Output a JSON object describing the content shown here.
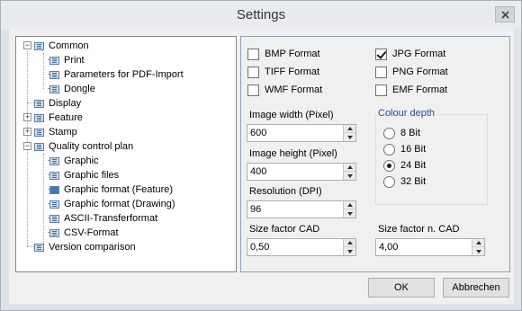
{
  "window": {
    "title": "Settings"
  },
  "tree": {
    "items": [
      {
        "label": "Common"
      },
      {
        "label": "Print"
      },
      {
        "label": "Parameters for PDF-Import"
      },
      {
        "label": "Dongle"
      },
      {
        "label": "Display"
      },
      {
        "label": "Feature"
      },
      {
        "label": "Stamp"
      },
      {
        "label": "Quality control plan"
      },
      {
        "label": "Graphic"
      },
      {
        "label": "Graphic files"
      },
      {
        "label": "Graphic format (Feature)"
      },
      {
        "label": "Graphic format (Drawing)"
      },
      {
        "label": "ASCII-Transferformat"
      },
      {
        "label": "CSV-Format"
      },
      {
        "label": "Version comparison"
      }
    ],
    "expander_minus": "−",
    "expander_plus": "+"
  },
  "formats": {
    "bmp": {
      "label": "BMP Format",
      "checked": false
    },
    "jpg": {
      "label": "JPG Format",
      "checked": true
    },
    "tiff": {
      "label": "TIFF Format",
      "checked": false
    },
    "png": {
      "label": "PNG Format",
      "checked": false
    },
    "wmf": {
      "label": "WMF Format",
      "checked": false
    },
    "emf": {
      "label": "EMF Format",
      "checked": false
    }
  },
  "fields": {
    "width_label": "Image width (Pixel)",
    "width_value": "600",
    "height_label": "Image height (Pixel)",
    "height_value": "400",
    "resolution_label": "Resolution (DPI)",
    "resolution_value": "96",
    "cad_label": "Size factor CAD",
    "cad_value": "0,50",
    "ncad_label": "Size factor n. CAD",
    "ncad_value": "4,00"
  },
  "colour_depth": {
    "title": "Colour depth",
    "options": [
      "8 Bit",
      "16 Bit",
      "24 Bit",
      "32 Bit"
    ],
    "selected": "24 Bit"
  },
  "buttons": {
    "ok": "OK",
    "cancel": "Abbrechen"
  },
  "colors": {
    "accent_title": "#1f4bb0",
    "selected_icon": "#3d82c9"
  }
}
